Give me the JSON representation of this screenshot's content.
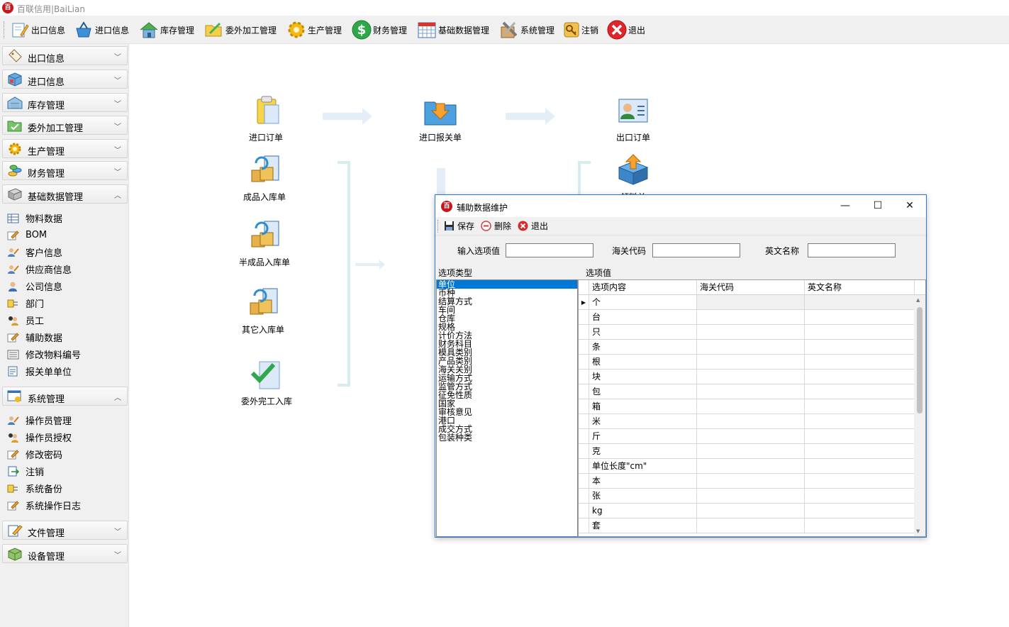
{
  "app": {
    "logo_char": "百",
    "title": "百联信用|BaiLian"
  },
  "toolbar": {
    "items": [
      {
        "label": "出口信息",
        "icon": "pencil-note-icon"
      },
      {
        "label": "进口信息",
        "icon": "basket-icon"
      },
      {
        "label": "库存管理",
        "icon": "house-icon"
      },
      {
        "label": "委外加工管理",
        "icon": "folder-icon"
      },
      {
        "label": "生产管理",
        "icon": "gear-icon"
      },
      {
        "label": "财务管理",
        "icon": "dollar-icon"
      },
      {
        "label": "基础数据管理",
        "icon": "calendar-grid-icon"
      },
      {
        "label": "系统管理",
        "icon": "tools-icon"
      },
      {
        "label": "注销",
        "icon": "key-icon"
      },
      {
        "label": "退出",
        "icon": "exit-x-icon"
      }
    ]
  },
  "sidebar": {
    "groups": [
      {
        "label": "出口信息",
        "expanded": false
      },
      {
        "label": "进口信息",
        "expanded": false
      },
      {
        "label": "库存管理",
        "expanded": false
      },
      {
        "label": "委外加工管理",
        "expanded": false
      },
      {
        "label": "生产管理",
        "expanded": false
      },
      {
        "label": "财务管理",
        "expanded": false
      },
      {
        "label": "基础数据管理",
        "expanded": true
      },
      {
        "label": "系统管理",
        "expanded": true
      },
      {
        "label": "文件管理",
        "expanded": false
      },
      {
        "label": "设备管理",
        "expanded": false
      }
    ],
    "basic_items": [
      "物料数据",
      "BOM",
      "客户信息",
      "供应商信息",
      "公司信息",
      "部门",
      "员工",
      "辅助数据",
      "修改物料编号",
      "报关单单位"
    ],
    "system_items": [
      "操作员管理",
      "操作员授权",
      "修改密码",
      "注销",
      "系统备份",
      "系统操作日志"
    ]
  },
  "flow": {
    "nodes": [
      "进口订单",
      "进口报关单",
      "出口订单",
      "成品入库单",
      "领料单",
      "半成品入库单",
      "其它入库单",
      "委外完工入库"
    ]
  },
  "dialog": {
    "logo_char": "百",
    "title": "辅助数据维护",
    "controls": {
      "minimize": "—",
      "maximize": "☐",
      "close": "✕"
    },
    "toolbar": {
      "save": "保存",
      "delete": "删除",
      "exit": "退出"
    },
    "fields": {
      "input_value_label": "输入选项值",
      "input_value": "",
      "customs_code_label": "海关代码",
      "customs_code": "",
      "english_name_label": "英文名称",
      "english_name": ""
    },
    "type_list_label": "选项类型",
    "value_grid_label": "选项值",
    "option_types": [
      "单位",
      "币种",
      "结算方式",
      "车间",
      "仓库",
      "规格",
      "计价方法",
      "财务科目",
      "模具类别",
      "产品类别",
      "海关关别",
      "运输方式",
      "监管方式",
      "征免性质",
      "国家",
      "审核意见",
      "港口",
      "成交方式",
      "包装种类"
    ],
    "selected_type": "单位",
    "grid": {
      "columns": [
        "选项内容",
        "海关代码",
        "英文名称"
      ],
      "rows": [
        "个",
        "台",
        "只",
        "条",
        "根",
        "块",
        "包",
        "箱",
        "米",
        "斤",
        "克",
        "单位长度\"cm\"",
        "本",
        "张",
        "kg",
        "套"
      ]
    }
  },
  "colors": {
    "accent": "#0078d7",
    "dialog_border": "#2b79d0",
    "arrow": "#dbeaf6",
    "bracket": "#d8ebee"
  }
}
